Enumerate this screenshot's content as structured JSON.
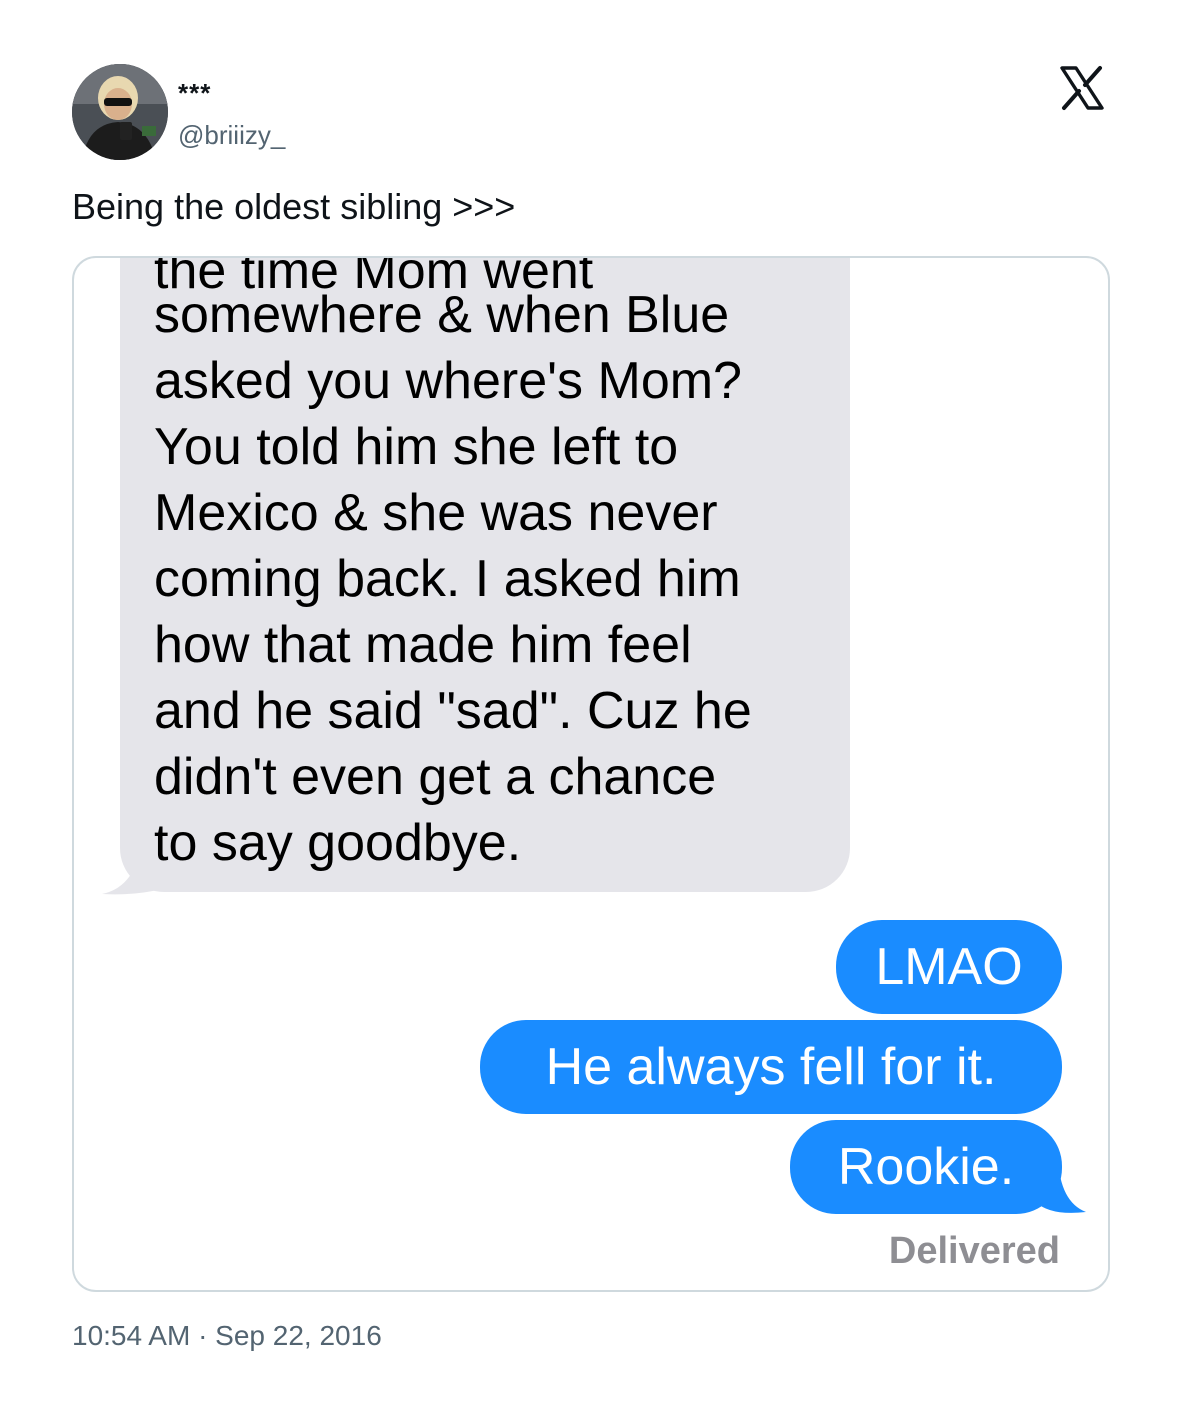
{
  "tweet": {
    "display_name": "***",
    "handle": "@briiizy_",
    "text": "Being the oldest sibling >>>",
    "timestamp": "10:54 AM · Sep 22, 2016",
    "logo_icon": "x-logo-icon"
  },
  "conversation": {
    "received": {
      "cut_off_line": "the time Mom went",
      "lines": [
        "somewhere & when Blue",
        "asked you where's Mom?",
        "You told him she left to",
        "Mexico & she was never",
        "coming back. I asked him",
        "how that made him feel",
        "and he said \"sad\". Cuz he",
        "didn't even get a chance",
        "to say goodbye."
      ]
    },
    "sent": [
      "LMAO",
      "He always fell for it.",
      "Rookie."
    ],
    "status": "Delivered"
  },
  "colors": {
    "sent_bubble": "#1a8cff",
    "received_bubble": "#e5e5ea",
    "card_border": "#cfd9de",
    "secondary_text": "#536471",
    "status_text": "#8e8e93"
  }
}
